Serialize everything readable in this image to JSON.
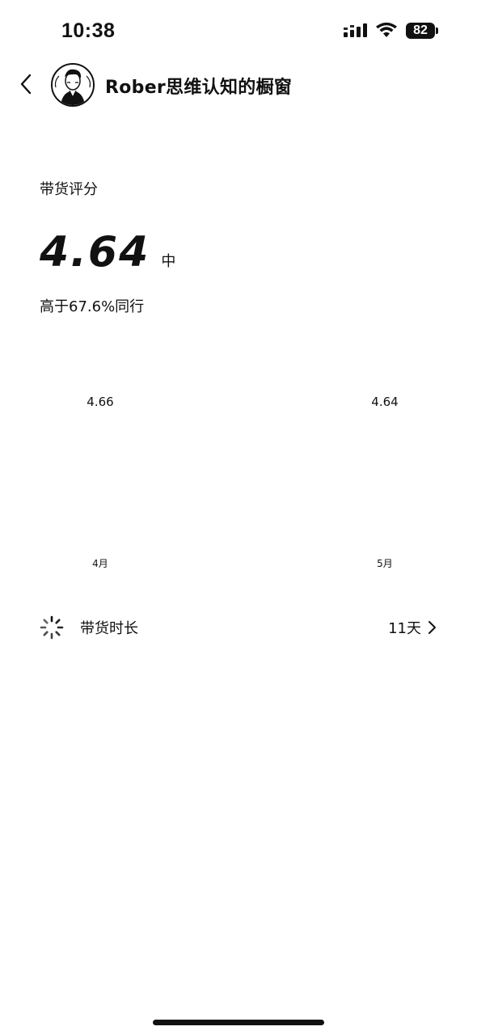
{
  "status_bar": {
    "time": "10:38",
    "battery": "82"
  },
  "header": {
    "title": "Rober思维认知的橱窗"
  },
  "score": {
    "label": "带货评分",
    "value": "4.64",
    "level": "中",
    "compare": "高于67.6%同行"
  },
  "chart_data": {
    "type": "line",
    "categories": [
      "4月",
      "5月"
    ],
    "series": [
      {
        "values": [
          4.66,
          4.64
        ]
      }
    ],
    "data_labels": [
      "4.66",
      "4.64"
    ]
  },
  "duration": {
    "label": "带货时长",
    "value": "11天"
  },
  "colors": {
    "text": "#111111",
    "background": "#ffffff"
  }
}
